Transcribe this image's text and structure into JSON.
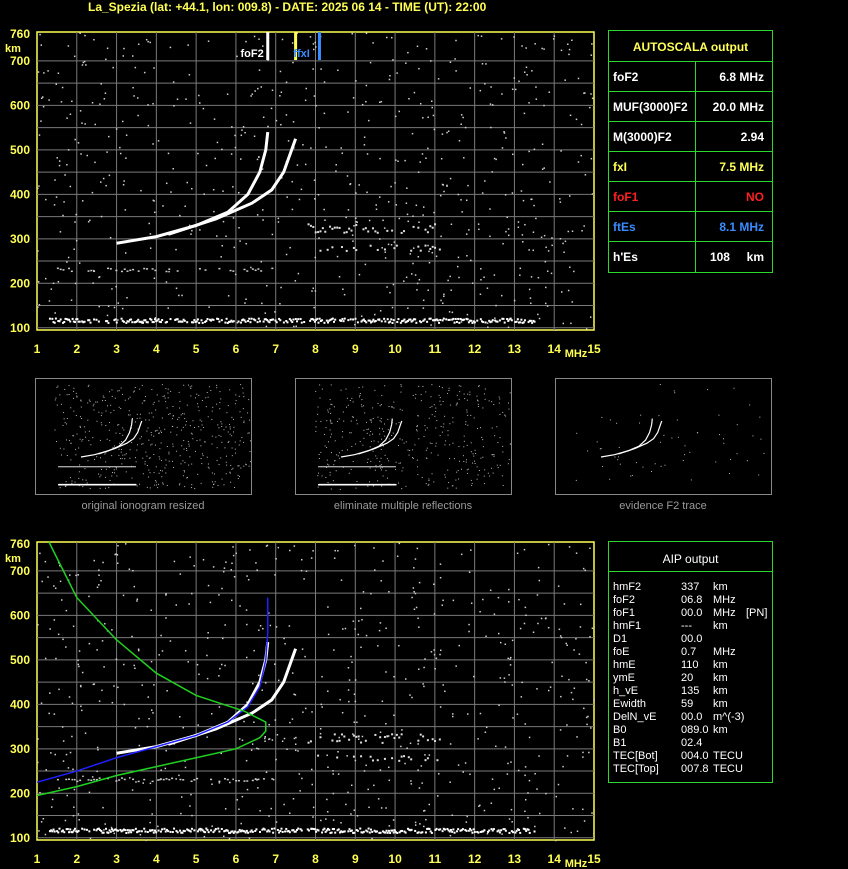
{
  "title": "La_Spezia (lat: +44.1, lon: 009.8) - DATE: 2025 06 14 - TIME (UT): 22:00",
  "colors": {
    "trace": "#ffffff",
    "grid": "#7a7a7a",
    "axis": "#ffff55",
    "frame": "#2bd82b",
    "fxI": "#ffff55",
    "ftEs": "#3a8cff",
    "foF1": "#ff2020",
    "profile_blue": "#2020ff",
    "profile_green": "#20d020"
  },
  "chart_data": [
    {
      "type": "scatter",
      "title": "",
      "xlabel": "MHz",
      "ylabel": "km",
      "xlim": [
        1,
        15
      ],
      "ylim": [
        95,
        765
      ],
      "x_ticks": [
        "1",
        "2",
        "3",
        "4",
        "5",
        "6",
        "7",
        "8",
        "9",
        "10",
        "11",
        "12",
        "13",
        "14",
        "15"
      ],
      "y_ticks": [
        "100",
        "200",
        "300",
        "400",
        "500",
        "600",
        "700",
        "760"
      ],
      "markers": [
        {
          "label": "foF2",
          "x": 6.8,
          "color": "#ffffff"
        },
        {
          "label": "fxI",
          "x": 7.5,
          "color": "#ffff55"
        },
        {
          "label": "ftEs",
          "x": 8.1,
          "color": "#3a8cff"
        }
      ],
      "series": [
        {
          "values": [
            [
              3.0,
              290
            ],
            [
              4.0,
              305
            ],
            [
              5.0,
              330
            ],
            [
              5.8,
              360
            ],
            [
              6.3,
              400
            ],
            [
              6.6,
              450
            ],
            [
              6.75,
              500
            ],
            [
              6.8,
              540
            ]
          ]
        },
        {
          "values": [
            [
              4.3,
              310
            ],
            [
              5.5,
              345
            ],
            [
              6.4,
              380
            ],
            [
              6.9,
              410
            ],
            [
              7.2,
              450
            ],
            [
              7.4,
              500
            ],
            [
              7.5,
              525
            ]
          ]
        }
      ]
    },
    {
      "type": "line",
      "title": "",
      "xlabel": "MHz",
      "ylabel": "km",
      "xlim": [
        1,
        15
      ],
      "ylim": [
        95,
        765
      ],
      "x_ticks": [
        "1",
        "2",
        "3",
        "4",
        "5",
        "6",
        "7",
        "8",
        "9",
        "10",
        "11",
        "12",
        "13",
        "14",
        "15"
      ],
      "y_ticks": [
        "100",
        "200",
        "300",
        "400",
        "500",
        "600",
        "700",
        "760"
      ],
      "series": [
        {
          "values": [
            [
              1.0,
              225
            ],
            [
              2.0,
              250
            ],
            [
              3.0,
              280
            ],
            [
              4.0,
              305
            ],
            [
              5.0,
              330
            ],
            [
              5.8,
              360
            ],
            [
              6.3,
              395
            ],
            [
              6.6,
              440
            ],
            [
              6.75,
              500
            ],
            [
              6.8,
              560
            ],
            [
              6.8,
              640
            ]
          ]
        },
        {
          "values": [
            [
              1.0,
              195
            ],
            [
              2.0,
              215
            ],
            [
              3.0,
              240
            ],
            [
              4.0,
              260
            ],
            [
              5.0,
              280
            ],
            [
              6.0,
              300
            ],
            [
              6.6,
              325
            ],
            [
              6.75,
              340
            ],
            [
              6.75,
              360
            ],
            [
              6.2,
              385
            ],
            [
              5.0,
              420
            ],
            [
              4.0,
              470
            ],
            [
              3.0,
              545
            ],
            [
              2.0,
              640
            ],
            [
              1.3,
              765
            ]
          ]
        }
      ]
    }
  ],
  "autoscala": {
    "header": "AUTOSCALA output",
    "rows": [
      {
        "key": "foF2",
        "value": "6.8 MHz",
        "color": "#ffffff"
      },
      {
        "key": "MUF(3000)F2",
        "value": "20.0 MHz",
        "color": "#ffffff"
      },
      {
        "key": "M(3000)F2",
        "value": "2.94",
        "color": "#ffffff"
      },
      {
        "key": "fxI",
        "value": "7.5 MHz",
        "color": "#ffff55"
      },
      {
        "key": "foF1",
        "value": "NO",
        "color": "#ff2020"
      },
      {
        "key": "ftEs",
        "value": "8.1 MHz",
        "color": "#3a8cff"
      },
      {
        "key": "h'Es",
        "value": "108     km",
        "color": "#ffffff"
      }
    ]
  },
  "thumbs": {
    "captions": [
      "original ionogram resized",
      "eliminate multiple reflections",
      "evidence F2 trace"
    ]
  },
  "aip": {
    "header": "AIP output",
    "lines": [
      [
        "hmF2",
        "337",
        "km",
        ""
      ],
      [
        "foF2",
        "06.8",
        "MHz",
        ""
      ],
      [
        "foF1",
        "00.0",
        "MHz",
        "[PN]"
      ],
      [
        "hmF1",
        "---",
        "km",
        ""
      ],
      [
        "D1",
        "00.0",
        "",
        ""
      ],
      [
        "foE",
        "0.7",
        "MHz",
        ""
      ],
      [
        "hmE",
        "110",
        "km",
        ""
      ],
      [
        "ymE",
        "20",
        "km",
        ""
      ],
      [
        "h_vE",
        "135",
        "km",
        ""
      ],
      [
        "Ewidth",
        "59",
        "km",
        ""
      ],
      [
        "DelN_vE",
        "00.0",
        "m^(-3)",
        ""
      ],
      [
        "B0",
        "089.0",
        "km",
        ""
      ],
      [
        "B1",
        "02.4",
        "",
        ""
      ],
      [
        "TEC[Bot]",
        "004.0",
        "TECU",
        ""
      ],
      [
        "TEC[Top]",
        "007.8",
        "TECU",
        ""
      ]
    ]
  }
}
